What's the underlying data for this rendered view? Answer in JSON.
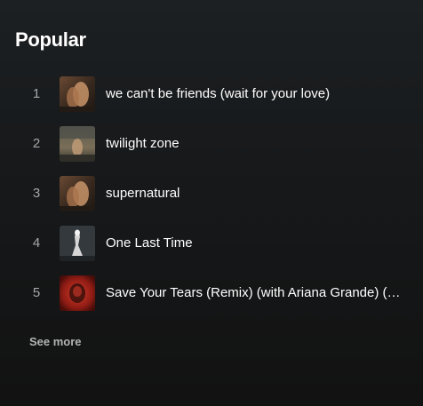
{
  "section": {
    "title": "Popular",
    "see_more_label": "See more"
  },
  "tracks": [
    {
      "number": "1",
      "title": "we can't be friends (wait for your love)",
      "art": "eternal-sunshine-cover"
    },
    {
      "number": "2",
      "title": "twilight zone",
      "art": "twilight-zone-cover"
    },
    {
      "number": "3",
      "title": "supernatural",
      "art": "eternal-sunshine-cover"
    },
    {
      "number": "4",
      "title": "One Last Time",
      "art": "my-everything-cover"
    },
    {
      "number": "5",
      "title": "Save Your Tears (Remix) (with Ariana Grande) (feat. Doja Cat)",
      "art": "after-hours-cover"
    }
  ]
}
